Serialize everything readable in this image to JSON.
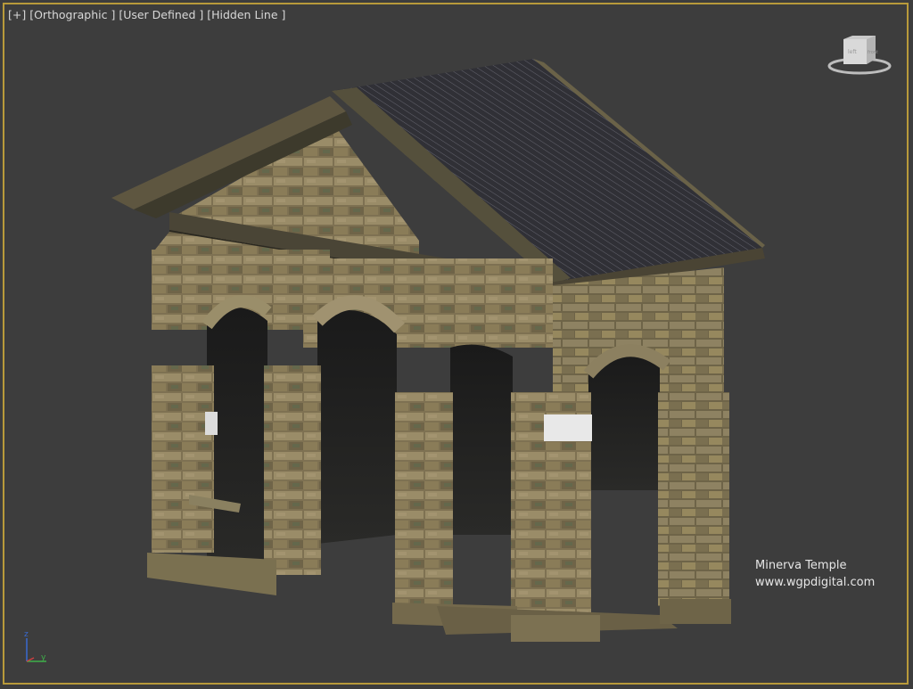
{
  "viewport": {
    "labels": {
      "plus": "[+]",
      "projection": "[Orthographic ]",
      "view": "[User Defined ]",
      "shading": "[Hidden Line ]"
    },
    "caption": {
      "line1": "Minerva Temple",
      "line2": "www.wgpdigital.com"
    },
    "viewcube_face": "left",
    "viewcube_face2": "front",
    "axis": {
      "z": "z",
      "y": "y",
      "x": "x"
    },
    "colors": {
      "background": "#3d3d3d",
      "border": "#b89a3a",
      "stone": "#8a7a5a",
      "roof": "#2e2e33"
    }
  }
}
